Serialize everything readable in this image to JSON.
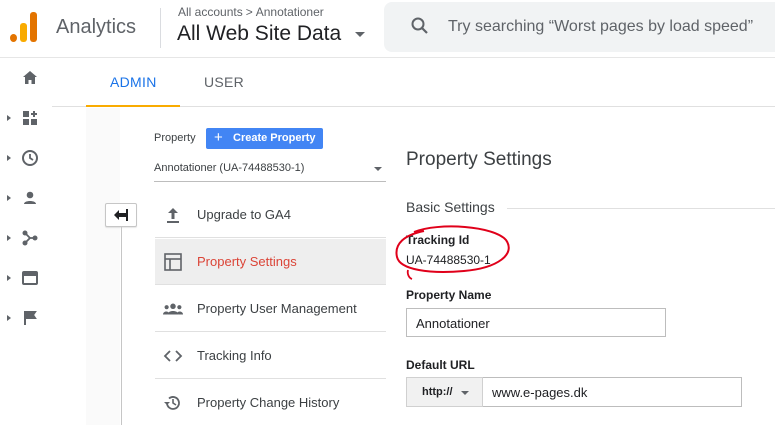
{
  "app": {
    "title": "Analytics"
  },
  "header": {
    "breadcrumb": [
      "All accounts",
      "Annotationer"
    ],
    "breadcrumb_separator": ">",
    "view_name": "All Web Site Data",
    "search_placeholder": "Try searching “Worst pages by load speed”"
  },
  "rail": {
    "items": [
      "home-icon",
      "customization-icon",
      "realtime-icon",
      "audience-icon",
      "acquisition-icon",
      "behavior-icon",
      "conversions-icon"
    ]
  },
  "tabs": [
    {
      "label": "ADMIN",
      "active": true
    },
    {
      "label": "USER",
      "active": false
    }
  ],
  "property_column": {
    "label": "Property",
    "create_button": "Create Property",
    "create_icon": "+",
    "selected_property": "Annotationer (UA-74488530-1)",
    "menu": [
      {
        "label": "Upgrade to GA4",
        "icon": "upload-icon",
        "active": false
      },
      {
        "label": "Property Settings",
        "icon": "property-settings-icon",
        "active": true
      },
      {
        "label": "Property User Management",
        "icon": "users-icon",
        "active": false
      },
      {
        "label": "Tracking Info",
        "icon": "code-icon",
        "active": false
      },
      {
        "label": "Property Change History",
        "icon": "history-icon",
        "active": false
      }
    ]
  },
  "settings": {
    "title": "Property Settings",
    "section": "Basic Settings",
    "tracking_id_label": "Tracking Id",
    "tracking_id": "UA-74488530-1",
    "property_name_label": "Property Name",
    "property_name": "Annotationer",
    "default_url_label": "Default URL",
    "protocol": "http://",
    "default_url": "www.e-pages.dk"
  },
  "colors": {
    "accent_blue": "#1a73e8",
    "tab_underline": "#f9ab00",
    "button_blue": "#4285f4",
    "active_menu_text": "#db4437",
    "annotation_red": "#e0001a"
  }
}
